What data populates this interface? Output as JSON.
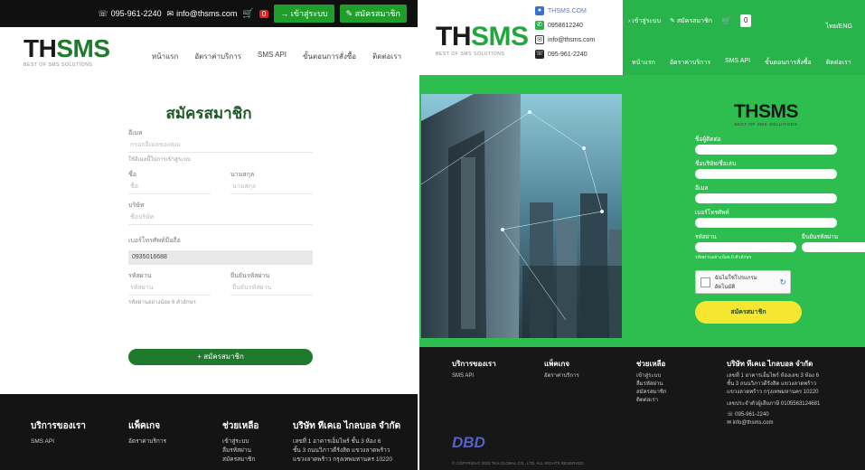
{
  "left": {
    "topbar": {
      "phone": "095-961-2240",
      "email": "info@thsms.com",
      "cart_count": "0",
      "login": "เข้าสู่ระบบ",
      "register": "สมัครสมาชิก"
    },
    "logo": {
      "main_a": "TH",
      "main_b": "SMS",
      "sub": "BEST OF SMS SOLUTIONS"
    },
    "nav": [
      "หน้าแรก",
      "อัตราค่าบริการ",
      "SMS API",
      "ขั้นตอนการสั่งซื้อ",
      "ติดต่อเรา"
    ],
    "page_title": "สมัครสมาชิก",
    "form": {
      "email_label": "อีเมล",
      "email_placeholder": "กรอกอีเมลของคุณ",
      "email_note": "ใช้อีเมลนี้ในการเข้าสู่ระบบ",
      "firstname_label": "ชื่อ",
      "firstname_placeholder": "ชื่อ",
      "lastname_label": "นามสกุล",
      "lastname_placeholder": "นามสกุล",
      "company_label": "บริษัท",
      "company_placeholder": "ชื่อบริษัท",
      "phone_label": "เบอร์โทรศัพท์มือถือ",
      "phone_value": "0935016688",
      "password_label": "รหัสผ่าน",
      "password_placeholder": "รหัสผ่าน",
      "confirm_label": "ยืนยันรหัสผ่าน",
      "confirm_placeholder": "ยืนยันรหัสผ่าน",
      "password_note": "รหัสผ่านอย่างน้อย 6 ตัวอักษร",
      "submit": "+ สมัครสมาชิก"
    },
    "footer": {
      "col1_title": "บริการของเรา",
      "col1_items": [
        "SMS API"
      ],
      "col2_title": "แพ็คเกจ",
      "col2_items": [
        "อัตราค่าบริการ"
      ],
      "col3_title": "ช่วยเหลือ",
      "col3_items": [
        "เข้าสู่ระบบ",
        "ลืมรหัสผ่าน",
        "สมัครสมาชิก"
      ],
      "col4_title": "บริษัท ทีเคเอ ไกลบอล จำกัด",
      "col4_items": [
        "เลขที่ 1 อาคารเอ็มไพร์ ชั้น 3 ห้อง 6",
        "ชั้น 3 ถนนวิภาวดีรังสิต แขวงลาดพร้าว",
        "แขวงลาดพร้าว กรุงเทพมหานคร 10220"
      ]
    }
  },
  "right": {
    "contacts": {
      "line": "THSMS.COM",
      "whatsapp": "0958612240",
      "email": "info@thsms.com",
      "phone": "095-961-2240"
    },
    "topmenu": {
      "login": "เข้าสู่ระบบ",
      "register": "สมัครสมาชิก",
      "cart_count": "0",
      "lang": "ไทย/ENG"
    },
    "logo": {
      "main_a": "TH",
      "main_b": "SMS",
      "sub": "BEST OF SMS SOLUTIONS"
    },
    "nav": [
      "หน้าแรก",
      "อัตราค่าบริการ",
      "SMS API",
      "ขั้นตอนการสั่งซื้อ",
      "ติดต่อเรา"
    ],
    "form": {
      "label1": "ชื่อผู้ติดต่อ",
      "label2": "ชื่อบริษัท/ชื่อเล่น",
      "label3": "อีเมล",
      "label4": "เบอร์โทรศัพท์",
      "label5": "รหัสผ่าน",
      "label6": "ยืนยันรหัสผ่าน",
      "note": "รหัสผ่านอย่างน้อย 6 ตัวอักษร",
      "captcha": "ฉันไม่ใช่โปรแกรมอัตโนมัติ",
      "submit": "สมัครสมาชิก"
    },
    "footer": {
      "col1_title": "บริการของเรา",
      "col1_items": [
        "SMS API"
      ],
      "col2_title": "แพ็คเกจ",
      "col2_items": [
        "อัตราค่าบริการ"
      ],
      "col3_title": "ช่วยเหลือ",
      "col3_items": [
        "เข้าสู่ระบบ",
        "ลืมรหัสผ่าน",
        "สมัครสมาชิก",
        "ติดต่อเรา"
      ],
      "col4_title": "บริษัท ทีเคเอ ไกลบอล จำกัด",
      "col4_items": [
        "เลขที่ 1 อาคารเอ็มไพร์ ห้องเลข 3 ห้อง 6",
        "ชั้น 3 ถนนวิภาวดีรังสิต แขวงลาดพร้าว",
        "แขวงลาดพร้าว กรุงเทพมหานคร 10220",
        "เลขประจำตัวผู้เสียภาษี 0105563124681",
        "095-961-2240",
        "info@thsms.com"
      ],
      "dbd": "DBD",
      "copyright": "© COPYRIGHT 2023 TKA GLOBAL CO., LTD. ALL RIGHTS RESERVED"
    }
  },
  "colors": {
    "brand_green": "#1f7a2c",
    "bright_green": "#2dbe4f",
    "yellow": "#f5e632",
    "dark": "#141414"
  }
}
